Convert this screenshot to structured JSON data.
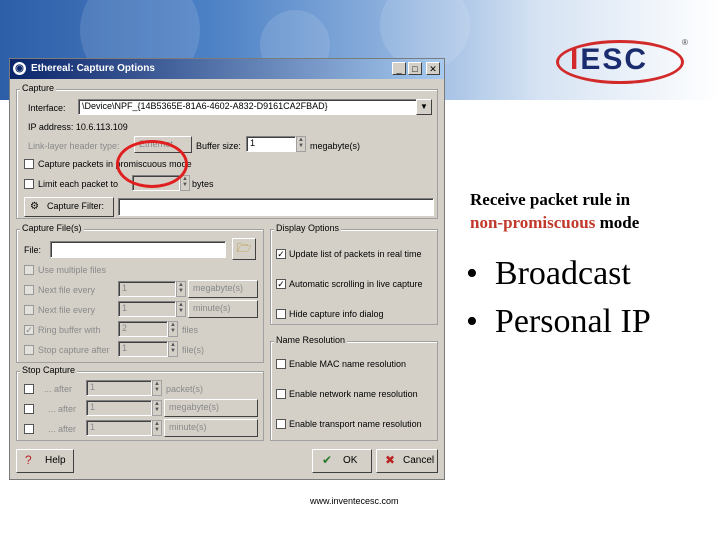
{
  "window": {
    "title": "Ethereal: Capture Options",
    "buttons": {
      "minimize": "_",
      "maximize": "□",
      "close": "✕"
    }
  },
  "capture": {
    "group_title": "Capture",
    "interface_label": "Interface:",
    "interface_value": "\\Device\\NPF_{14B5365E-81A6-4602-A832-D9161CA2FBAD}",
    "ip_address": "IP address: 10.6.113.109",
    "link_layer_label": "Link-layer header type:",
    "link_layer_value": "Ethernet",
    "buffer_label": "Buffer size:",
    "buffer_value": "1",
    "buffer_unit": "megabyte(s)",
    "promiscuous_label": "Capture packets in promiscuous mode",
    "promiscuous_checked": false,
    "limit_label": "Limit each packet to",
    "limit_unit": "bytes",
    "filter_button": "Capture Filter:",
    "filter_value": ""
  },
  "capture_files": {
    "group_title": "Capture File(s)",
    "file_label": "File:",
    "file_value": "",
    "multiple_files": "Use multiple files",
    "next_file_1": "Next file every",
    "next_file_1_value": "1",
    "next_file_1_unit": "megabyte(s)",
    "next_file_2": "Next file every",
    "next_file_2_value": "1",
    "next_file_2_unit": "minute(s)",
    "ring_buffer": "Ring buffer with",
    "ring_buffer_value": "2",
    "ring_buffer_unit": "files",
    "stop_capture": "Stop capture after",
    "stop_capture_value": "1",
    "stop_capture_unit": "file(s)"
  },
  "stop_capture": {
    "group_title": "Stop Capture",
    "after_label": "... after",
    "rows": [
      {
        "value": "1",
        "unit": "packet(s)"
      },
      {
        "value": "1",
        "unit": "megabyte(s)"
      },
      {
        "value": "1",
        "unit": "minute(s)"
      }
    ]
  },
  "display_options": {
    "group_title": "Display Options",
    "update_list": "Update list of packets in real time",
    "auto_scroll": "Automatic scrolling in live capture",
    "hide_info": "Hide capture info dialog"
  },
  "name_resolution": {
    "group_title": "Name Resolution",
    "mac": "Enable MAC name resolution",
    "network": "Enable network name resolution",
    "transport": "Enable transport name resolution"
  },
  "footer_buttons": {
    "help": "Help",
    "ok": "OK",
    "cancel": "Cancel"
  },
  "slide": {
    "note_line1": "Receive packet rule in",
    "note_red": "non-promiscuous",
    "note_tail": " mode",
    "bullets": [
      "Broadcast",
      "Personal IP"
    ],
    "footer_url": "www.inventecesc.com",
    "logo_text": "ESC",
    "logo_i": "I",
    "logo_reg": "®",
    "check_mark": "✓",
    "annotation_color": "#e02020",
    "accent_red": "#c0392b"
  }
}
